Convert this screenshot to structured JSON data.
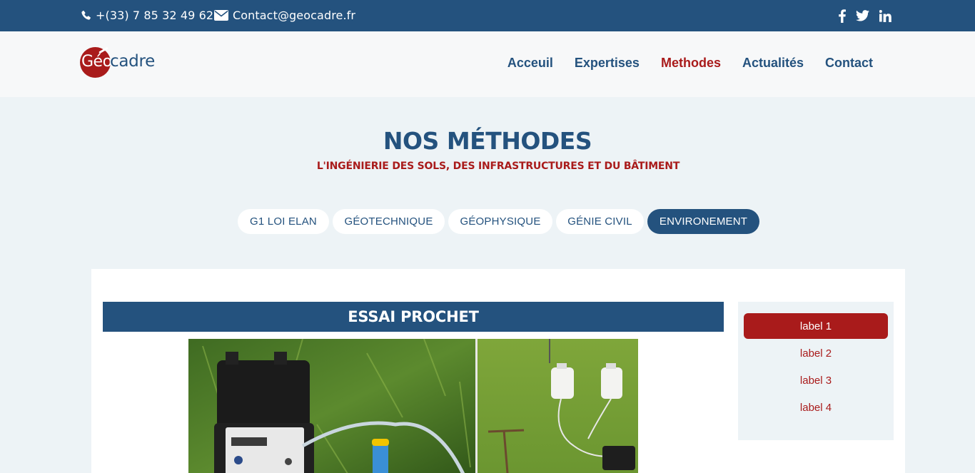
{
  "topbar": {
    "phone": "+(33) 7 85 32 49 62",
    "email": "Contact@geocadre.fr",
    "social_icons": [
      "facebook-icon",
      "twitter-icon",
      "linkedin-icon"
    ]
  },
  "logo": {
    "text_geo": "Géo",
    "text_cadre": "cadre"
  },
  "nav": {
    "items": [
      {
        "label": "Acceuil"
      },
      {
        "label": "Expertises"
      },
      {
        "label": "Methodes",
        "active": true
      },
      {
        "label": "Actualités"
      },
      {
        "label": "Contact"
      }
    ]
  },
  "hero": {
    "title": "NOS MÉTHODES",
    "subtitle": "L'INGÉNIERIE DES SOLS, DES INFRASTRUCTURES ET DU BÂTIMENT"
  },
  "tabs": [
    {
      "label": "G1 LOI ELAN"
    },
    {
      "label": "GÉOTECHNIQUE"
    },
    {
      "label": "GÉOPHYSIQUE"
    },
    {
      "label": "GÉNIE CIVIL"
    },
    {
      "label": "ENVIRONEMENT",
      "active": true
    }
  ],
  "section": {
    "title": "ESSAI PROCHET"
  },
  "sidebar": {
    "items": [
      {
        "label": "label 1",
        "active": true
      },
      {
        "label": "label 2"
      },
      {
        "label": "label 3"
      },
      {
        "label": "label 4"
      }
    ]
  },
  "colors": {
    "primary": "#24527e",
    "accent": "#a91b1b",
    "background": "#edf3f6"
  }
}
